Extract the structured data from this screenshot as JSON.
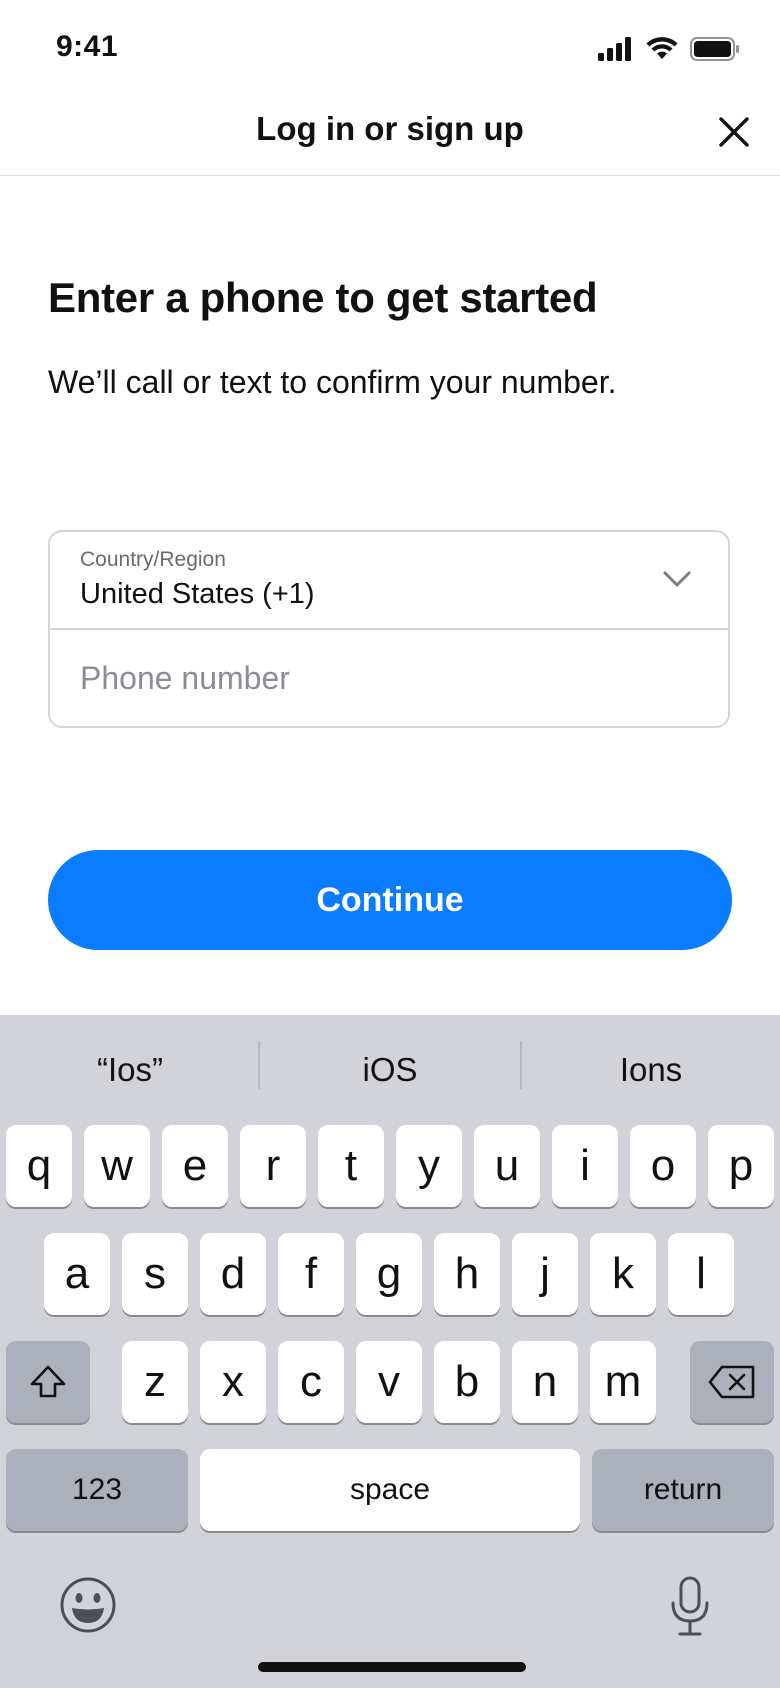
{
  "status_bar": {
    "time": "9:41"
  },
  "header": {
    "title": "Log in or sign up"
  },
  "content": {
    "heading": "Enter a phone to get started",
    "subtext": "We’ll call or text to confirm your number."
  },
  "form": {
    "country_label": "Country/Region",
    "country_value": "United States (+1)",
    "phone_placeholder": "Phone number"
  },
  "continue_label": "Continue",
  "colors": {
    "primary": "#0a7cff",
    "keyboard_bg": "#d1d3d9"
  },
  "keyboard": {
    "suggestions": [
      "“Ios”",
      "iOS",
      "Ions"
    ],
    "row1": [
      "q",
      "w",
      "e",
      "r",
      "t",
      "y",
      "u",
      "i",
      "o",
      "p"
    ],
    "row2": [
      "a",
      "s",
      "d",
      "f",
      "g",
      "h",
      "j",
      "k",
      "l"
    ],
    "row3": [
      "z",
      "x",
      "c",
      "v",
      "b",
      "n",
      "m"
    ],
    "numbers_label": "123",
    "space_label": "space",
    "return_label": "return"
  }
}
